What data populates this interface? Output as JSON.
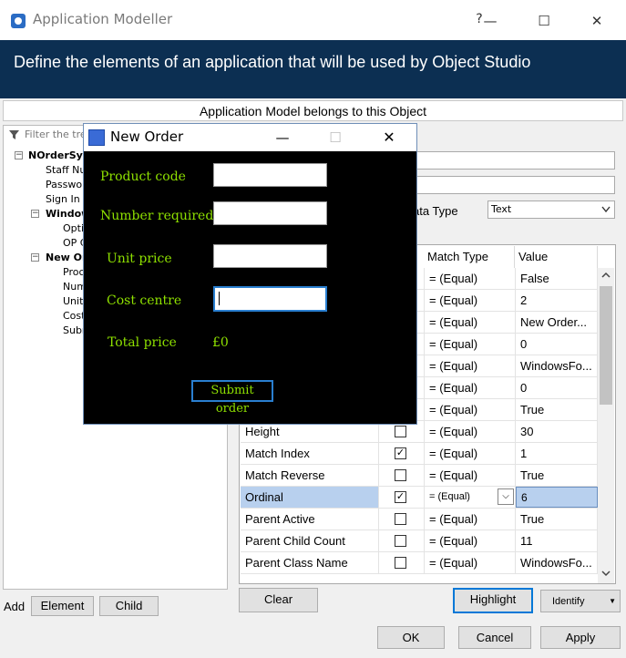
{
  "window": {
    "title": "Application Modeller",
    "help": "?",
    "minimize": "—",
    "maximize": "☐",
    "close": "✕"
  },
  "banner": {
    "text": "Define the elements of an application that will be used by Object Studio"
  },
  "belongs": {
    "text": "Application Model belongs to this Object"
  },
  "tree": {
    "filter_placeholder": "Filter the tre",
    "items": [
      {
        "label": "NOrderSys",
        "bold": true
      },
      {
        "label": "Staff Nu"
      },
      {
        "label": "Passwo"
      },
      {
        "label": "Sign In"
      },
      {
        "label": "Window",
        "bold": true
      },
      {
        "label": "Opti"
      },
      {
        "label": "OP C"
      },
      {
        "label": "New Ord",
        "bold": true
      },
      {
        "label": "Proc"
      },
      {
        "label": "Num"
      },
      {
        "label": "Unit"
      },
      {
        "label": "Cost"
      },
      {
        "label": "Subr"
      }
    ]
  },
  "props": {
    "datatype_label": "ata Type",
    "datatype_value": "Text"
  },
  "grid": {
    "headers": {
      "match_type": "Match Type",
      "value": "Value"
    },
    "rows": [
      {
        "name": "",
        "checked": false,
        "type": "=  (Equal)",
        "value": "False"
      },
      {
        "name": "",
        "checked": false,
        "type": "=  (Equal)",
        "value": "2"
      },
      {
        "name": "",
        "checked": false,
        "type": "=  (Equal)",
        "value": "New Order..."
      },
      {
        "name": "",
        "checked": false,
        "type": "=  (Equal)",
        "value": "0"
      },
      {
        "name": "",
        "checked": false,
        "type": "=  (Equal)",
        "value": "WindowsFo..."
      },
      {
        "name": "",
        "checked": false,
        "type": "=  (Equal)",
        "value": "0"
      },
      {
        "name": "",
        "checked": false,
        "type": "=  (Equal)",
        "value": "True"
      },
      {
        "name": "Height",
        "checked": false,
        "type": "=  (Equal)",
        "value": "30"
      },
      {
        "name": "Match Index",
        "checked": true,
        "type": "=  (Equal)",
        "value": "1"
      },
      {
        "name": "Match Reverse",
        "checked": false,
        "type": "=  (Equal)",
        "value": "True"
      },
      {
        "name": "Ordinal",
        "checked": true,
        "type": "=  (Equal)",
        "value": "6",
        "selected": true
      },
      {
        "name": "Parent Active",
        "checked": false,
        "type": "=  (Equal)",
        "value": "True"
      },
      {
        "name": "Parent Child Count",
        "checked": false,
        "type": "=  (Equal)",
        "value": "11"
      },
      {
        "name": "Parent Class Name",
        "checked": false,
        "type": "=  (Equal)",
        "value": "WindowsFo..."
      }
    ]
  },
  "buttons": {
    "add_label": "Add",
    "element": "Element",
    "child": "Child",
    "clear": "Clear",
    "highlight": "Highlight",
    "identify": "Identify",
    "ok": "OK",
    "cancel": "Cancel",
    "apply": "Apply"
  },
  "modal": {
    "title": "New Order",
    "minimize": "—",
    "maximize": "☐",
    "close": "✕",
    "product_code": "Product code",
    "number_required": "Number required",
    "unit_price": "Unit price",
    "cost_centre": "Cost centre",
    "total_price_label": "Total price",
    "total_price_value": "£0",
    "submit": "Submit order"
  }
}
